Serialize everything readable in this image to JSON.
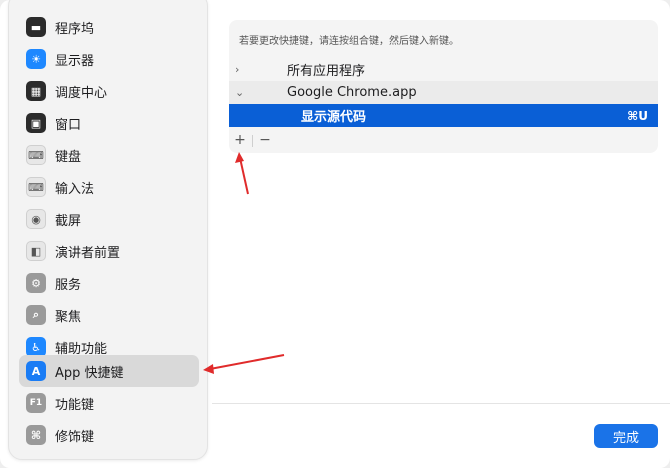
{
  "sidebar": {
    "items": [
      {
        "label": "程序坞",
        "icon": "dock-icon",
        "glyph": "▬"
      },
      {
        "label": "显示器",
        "icon": "display-icon",
        "glyph": "☀"
      },
      {
        "label": "调度中心",
        "icon": "mission-control-icon",
        "glyph": "▦"
      },
      {
        "label": "窗口",
        "icon": "window-icon",
        "glyph": "▣"
      },
      {
        "label": "键盘",
        "icon": "keyboard-icon",
        "glyph": "⌨"
      },
      {
        "label": "输入法",
        "icon": "input-method-icon",
        "glyph": "⌨"
      },
      {
        "label": "截屏",
        "icon": "screenshot-icon",
        "glyph": "◉"
      },
      {
        "label": "演讲者前置",
        "icon": "presenter-icon",
        "glyph": "◧"
      },
      {
        "label": "服务",
        "icon": "services-icon",
        "glyph": "⚙"
      },
      {
        "label": "聚焦",
        "icon": "spotlight-icon",
        "glyph": "⌕"
      },
      {
        "label": "辅助功能",
        "icon": "accessibility-icon",
        "glyph": "♿"
      },
      {
        "label": "App 快捷键",
        "icon": "app-store-icon",
        "glyph": "A"
      },
      {
        "label": "功能键",
        "icon": "function-key-icon",
        "glyph": "F1"
      },
      {
        "label": "修饰键",
        "icon": "modifier-key-icon",
        "glyph": "⌘"
      }
    ],
    "selected_index": 11
  },
  "panel": {
    "hint": "若要更改快捷键，请连按组合键，然后键入新键。",
    "rows": [
      {
        "chevron": "›",
        "label": "所有应用程序"
      },
      {
        "chevron": "⌄",
        "label": "Google Chrome.app"
      },
      {
        "chevron": "",
        "label": "显示源代码",
        "shortcut": "⌘U"
      }
    ],
    "add_label": "+",
    "remove_label": "−"
  },
  "footer": {
    "done_label": "完成"
  },
  "colors": {
    "accent": "#1a73e8",
    "selection": "#0a5fd6",
    "annotation_arrow": "#e02b2b"
  }
}
